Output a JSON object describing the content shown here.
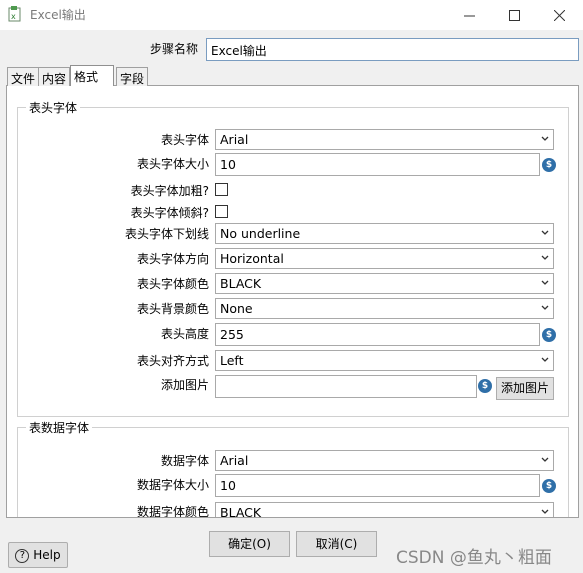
{
  "window": {
    "title": "Excel输出"
  },
  "step": {
    "label": "步骤名称",
    "value": "Excel输出"
  },
  "tabs": [
    {
      "label": "文件"
    },
    {
      "label": "内容"
    },
    {
      "label": "格式"
    },
    {
      "label": "字段"
    }
  ],
  "header_group": {
    "title": "表头字体",
    "font_label": "表头字体",
    "font_value": "Arial",
    "size_label": "表头字体大小",
    "size_value": "10",
    "bold_label": "表头字体加粗?",
    "italic_label": "表头字体倾斜?",
    "underline_label": "表头字体下划线",
    "underline_value": "No underline",
    "direction_label": "表头字体方向",
    "direction_value": "Horizontal",
    "color_label": "表头字体颜色",
    "color_value": "BLACK",
    "bg_label": "表头背景颜色",
    "bg_value": "None",
    "height_label": "表头高度",
    "height_value": "255",
    "align_label": "表头对齐方式",
    "align_value": "Left",
    "image_label": "添加图片",
    "image_value": "",
    "image_button": "添加图片"
  },
  "data_group": {
    "title": "表数据字体",
    "font_label": "数据字体",
    "font_value": "Arial",
    "size_label": "数据字体大小",
    "size_value": "10",
    "color_label": "数据字体颜色",
    "color_value": "BLACK"
  },
  "footer": {
    "ok": "确定(O)",
    "cancel": "取消(C)",
    "help": "Help"
  },
  "watermark": "CSDN @鱼丸丶粗面",
  "var_icon_glyph": "$"
}
